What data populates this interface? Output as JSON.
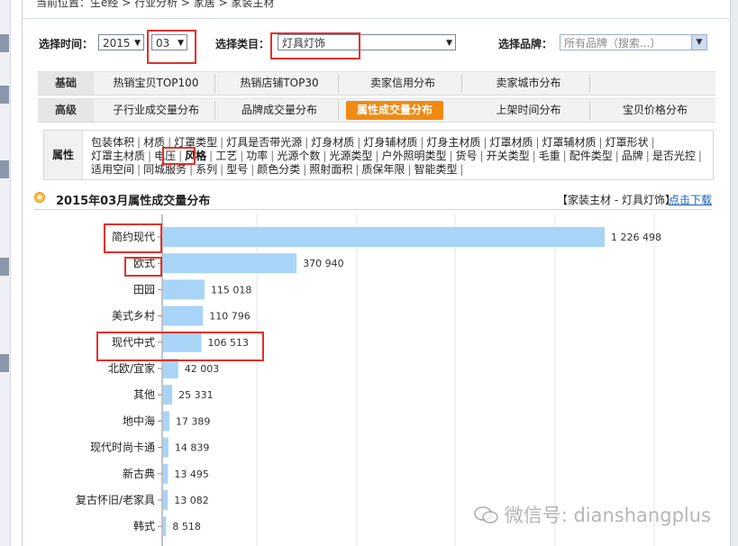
{
  "breadcrumb": "当前位置：生e经 > 行业分析 > 家居 > 家装主材",
  "filters": {
    "time_label": "选择时间：",
    "year": "2015",
    "month": "03",
    "category_label": "选择类目：",
    "category": "灯具灯饰",
    "brand_label": "选择品牌：",
    "brand_placeholder": "所有品牌（搜索...）"
  },
  "tabs": {
    "basic": {
      "label": "基础",
      "items": [
        "热销宝贝TOP100",
        "热销店铺TOP30",
        "卖家信用分布",
        "卖家城市分布"
      ]
    },
    "advanced": {
      "label": "高级",
      "items": [
        "子行业成交量分布",
        "品牌成交量分布",
        "属性成交量分布",
        "上架时间分布",
        "宝贝价格分布"
      ],
      "active_index": 2
    }
  },
  "attributes": {
    "label": "属性",
    "items": [
      "包装体积",
      "材质",
      "灯罩类型",
      "灯具是否带光源",
      "灯身材质",
      "灯身辅材质",
      "灯身主材质",
      "灯罩材质",
      "灯罩辅材质",
      "灯罩形状",
      "灯罩主材质",
      "电压",
      "风格",
      "工艺",
      "功率",
      "光源个数",
      "光源类型",
      "户外照明类型",
      "货号",
      "开关类型",
      "毛重",
      "配件类型",
      "品牌",
      "是否光控",
      "适用空间",
      "同城服务",
      "系列",
      "型号",
      "颜色分类",
      "照射面积",
      "质保年限",
      "智能类型"
    ],
    "active": "风格"
  },
  "chart_header": {
    "title": "2015年03月属性成交量分布",
    "crumb": "【家装主材 - 灯具灯饰】",
    "download": "点击下载"
  },
  "chart_data": {
    "type": "bar",
    "orientation": "horizontal",
    "bar_color": "#a8d4f7",
    "categories": [
      "简约现代",
      "欧式",
      "田园",
      "美式乡村",
      "现代中式",
      "北欧/宜家",
      "其他",
      "地中海",
      "现代时尚卡通",
      "新古典",
      "复古怀旧/老家具",
      "韩式"
    ],
    "values": [
      1226498,
      370940,
      115018,
      110796,
      106513,
      42003,
      25331,
      17389,
      14839,
      13495,
      13082,
      8518
    ],
    "value_labels": [
      "1 226 498",
      "370 940",
      "115 018",
      "110 796",
      "106 513",
      "42 003",
      "25 331",
      "17 389",
      "14 839",
      "13 495",
      "13 082",
      "8 518"
    ],
    "grid": true,
    "highlighted": [
      "简约现代",
      "欧式",
      "现代中式"
    ]
  },
  "watermark": "微信号: dianshangplus"
}
